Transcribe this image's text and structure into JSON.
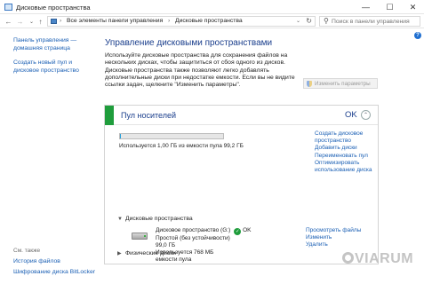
{
  "window": {
    "title": "Дисковые пространства"
  },
  "address": {
    "crumbs": [
      "Все элементы панели управления",
      "Дисковые пространства"
    ],
    "search_placeholder": "Поиск в панели управления"
  },
  "left_pane": {
    "links": [
      "Панель управления — домашняя страница",
      "Создать новый пул и дисковое пространство"
    ],
    "see_also_label": "См. также",
    "see_also_links": [
      "История файлов",
      "Шифрование диска BitLocker"
    ]
  },
  "main": {
    "title": "Управление дисковыми пространствами",
    "description": "Используйте дисковые пространства для сохранения файлов на нескольких дисках, чтобы защититься от сбоя одного из дисков. Дисковые пространства также позволяют легко добавлять дополнительные диски при недостатке емкости. Если вы не видите ссылки задач, щелкните \"Изменить параметры\".",
    "change_button": "Изменить параметры"
  },
  "pool": {
    "name": "Пул носителей",
    "status": "OK",
    "usage_fraction": 0.01,
    "usage_text": "Используется 1,00 ГБ из емкости пула 99,2 ГБ",
    "links": [
      "Создать дисковое пространство",
      "Добавить диски",
      "Переименовать пул",
      "Оптимизировать использование диска"
    ],
    "spaces_label": "Дисковые пространства",
    "physical_label": "Физические диски"
  },
  "space": {
    "name": "Дисковое пространство (G:)",
    "status": "OK",
    "resiliency": "Простой (без устойчивости)",
    "size": "99,0 ГБ",
    "used": "Используется 768 МБ",
    "used_suffix": "емкости пула",
    "links": [
      "Просмотреть файлы",
      "Изменить",
      "Удалить"
    ]
  },
  "watermark": "VIARUM",
  "colors": {
    "accent_green": "#1f9d3c",
    "link": "#1a5fb4",
    "title": "#1a3e8c"
  }
}
